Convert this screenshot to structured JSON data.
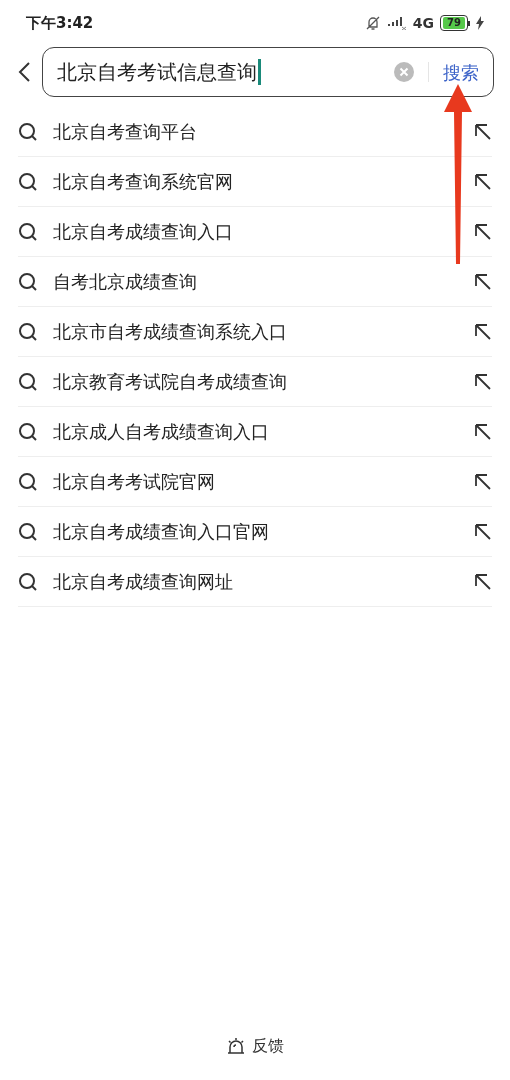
{
  "status_bar": {
    "time": "下午3:42",
    "network": "4G",
    "battery": "79"
  },
  "search": {
    "value": "北京自考考试信息查询",
    "button": "搜索"
  },
  "suggestions": [
    {
      "text": "北京自考查询平台"
    },
    {
      "text": "北京自考查询系统官网"
    },
    {
      "text": "北京自考成绩查询入口"
    },
    {
      "text": "自考北京成绩查询"
    },
    {
      "text": "北京市自考成绩查询系统入口"
    },
    {
      "text": "北京教育考试院自考成绩查询"
    },
    {
      "text": "北京成人自考成绩查询入口"
    },
    {
      "text": "北京自考考试院官网"
    },
    {
      "text": "北京自考成绩查询入口官网"
    },
    {
      "text": "北京自考成绩查询网址"
    }
  ],
  "footer": {
    "feedback": "反馈"
  }
}
